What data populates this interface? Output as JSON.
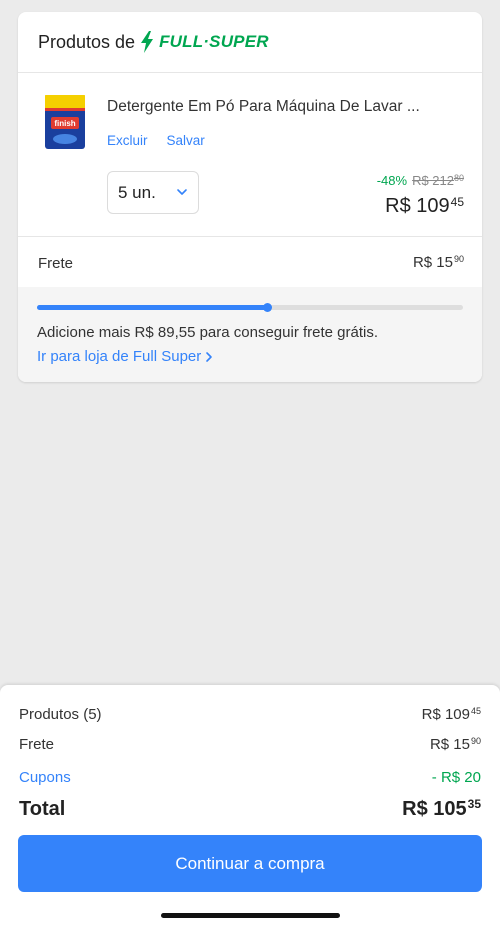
{
  "card": {
    "title": "Produtos de",
    "store_name": "FULL·SUPER",
    "store_color": "#00a650"
  },
  "product": {
    "title": "Detergente Em Pó Para Máquina De Lavar ...",
    "thumb_text": "finish",
    "remove_label": "Excluir",
    "save_label": "Salvar",
    "quantity": "5 un.",
    "discount": "-48%",
    "old_price_int": "R$ 212",
    "old_price_cents": "80",
    "price_int": "R$ 109",
    "price_cents": "45"
  },
  "shipping": {
    "label": "Frete",
    "price_int": "R$ 15",
    "price_cents": "90",
    "progress": 0.54,
    "message": "Adicione mais R$ 89,55 para conseguir frete grátis.",
    "store_link": "Ir para loja de Full Super"
  },
  "summary": {
    "products_label": "Produtos (5)",
    "products_int": "R$ 109",
    "products_cents": "45",
    "shipping_label": "Frete",
    "shipping_int": "R$ 15",
    "shipping_cents": "90",
    "coupons_label": "Cupons",
    "coupons_value": "- R$ 20",
    "total_label": "Total",
    "total_int": "R$ 105",
    "total_cents": "35",
    "cta_label": "Continuar a compra"
  },
  "colors": {
    "accent": "#3483fa",
    "success": "#00a650",
    "background": "#ebebeb"
  }
}
